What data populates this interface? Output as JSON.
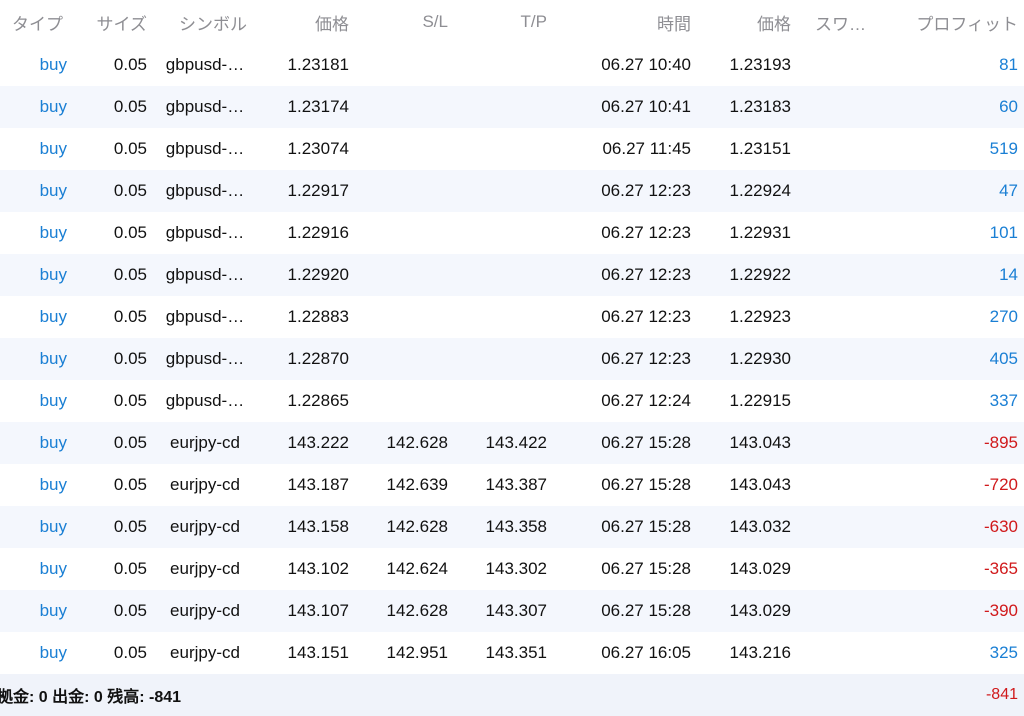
{
  "header": {
    "type": "タイプ",
    "size": "サイズ",
    "symbol": "シンボル",
    "price": "価格",
    "sl": "S/L",
    "tp": "T/P",
    "time": "時間",
    "price2": "価格",
    "swap": "スワ…",
    "profit": "プロフィット"
  },
  "rows": [
    {
      "type": "buy",
      "size": "0.05",
      "symbol": "gbpusd-…",
      "price": "1.23181",
      "sl": "",
      "tp": "",
      "time": "06.27 10:40",
      "price2": "1.23193",
      "swap": "",
      "profit": "81"
    },
    {
      "type": "buy",
      "size": "0.05",
      "symbol": "gbpusd-…",
      "price": "1.23174",
      "sl": "",
      "tp": "",
      "time": "06.27 10:41",
      "price2": "1.23183",
      "swap": "",
      "profit": "60"
    },
    {
      "type": "buy",
      "size": "0.05",
      "symbol": "gbpusd-…",
      "price": "1.23074",
      "sl": "",
      "tp": "",
      "time": "06.27 11:45",
      "price2": "1.23151",
      "swap": "",
      "profit": "519"
    },
    {
      "type": "buy",
      "size": "0.05",
      "symbol": "gbpusd-…",
      "price": "1.22917",
      "sl": "",
      "tp": "",
      "time": "06.27 12:23",
      "price2": "1.22924",
      "swap": "",
      "profit": "47"
    },
    {
      "type": "buy",
      "size": "0.05",
      "symbol": "gbpusd-…",
      "price": "1.22916",
      "sl": "",
      "tp": "",
      "time": "06.27 12:23",
      "price2": "1.22931",
      "swap": "",
      "profit": "101"
    },
    {
      "type": "buy",
      "size": "0.05",
      "symbol": "gbpusd-…",
      "price": "1.22920",
      "sl": "",
      "tp": "",
      "time": "06.27 12:23",
      "price2": "1.22922",
      "swap": "",
      "profit": "14"
    },
    {
      "type": "buy",
      "size": "0.05",
      "symbol": "gbpusd-…",
      "price": "1.22883",
      "sl": "",
      "tp": "",
      "time": "06.27 12:23",
      "price2": "1.22923",
      "swap": "",
      "profit": "270"
    },
    {
      "type": "buy",
      "size": "0.05",
      "symbol": "gbpusd-…",
      "price": "1.22870",
      "sl": "",
      "tp": "",
      "time": "06.27 12:23",
      "price2": "1.22930",
      "swap": "",
      "profit": "405"
    },
    {
      "type": "buy",
      "size": "0.05",
      "symbol": "gbpusd-…",
      "price": "1.22865",
      "sl": "",
      "tp": "",
      "time": "06.27 12:24",
      "price2": "1.22915",
      "swap": "",
      "profit": "337"
    },
    {
      "type": "buy",
      "size": "0.05",
      "symbol": "eurjpy-cd",
      "price": "143.222",
      "sl": "142.628",
      "tp": "143.422",
      "time": "06.27 15:28",
      "price2": "143.043",
      "swap": "",
      "profit": "-895"
    },
    {
      "type": "buy",
      "size": "0.05",
      "symbol": "eurjpy-cd",
      "price": "143.187",
      "sl": "142.639",
      "tp": "143.387",
      "time": "06.27 15:28",
      "price2": "143.043",
      "swap": "",
      "profit": "-720"
    },
    {
      "type": "buy",
      "size": "0.05",
      "symbol": "eurjpy-cd",
      "price": "143.158",
      "sl": "142.628",
      "tp": "143.358",
      "time": "06.27 15:28",
      "price2": "143.032",
      "swap": "",
      "profit": "-630"
    },
    {
      "type": "buy",
      "size": "0.05",
      "symbol": "eurjpy-cd",
      "price": "143.102",
      "sl": "142.624",
      "tp": "143.302",
      "time": "06.27 15:28",
      "price2": "143.029",
      "swap": "",
      "profit": "-365"
    },
    {
      "type": "buy",
      "size": "0.05",
      "symbol": "eurjpy-cd",
      "price": "143.107",
      "sl": "142.628",
      "tp": "143.307",
      "time": "06.27 15:28",
      "price2": "143.029",
      "swap": "",
      "profit": "-390"
    },
    {
      "type": "buy",
      "size": "0.05",
      "symbol": "eurjpy-cd",
      "price": "143.151",
      "sl": "142.951",
      "tp": "143.351",
      "time": "06.27 16:05",
      "price2": "143.216",
      "swap": "",
      "profit": "325"
    }
  ],
  "footer": {
    "summary": "拠金: 0 出金: 0 残高: -841",
    "profit": "-841"
  },
  "colors": {
    "buy": "#1a7fd4",
    "profit_positive": "#1a7fd4",
    "profit_negative": "#d0191b",
    "header_text": "#8e8e93",
    "alt_row_background": "#f4f7fd"
  }
}
